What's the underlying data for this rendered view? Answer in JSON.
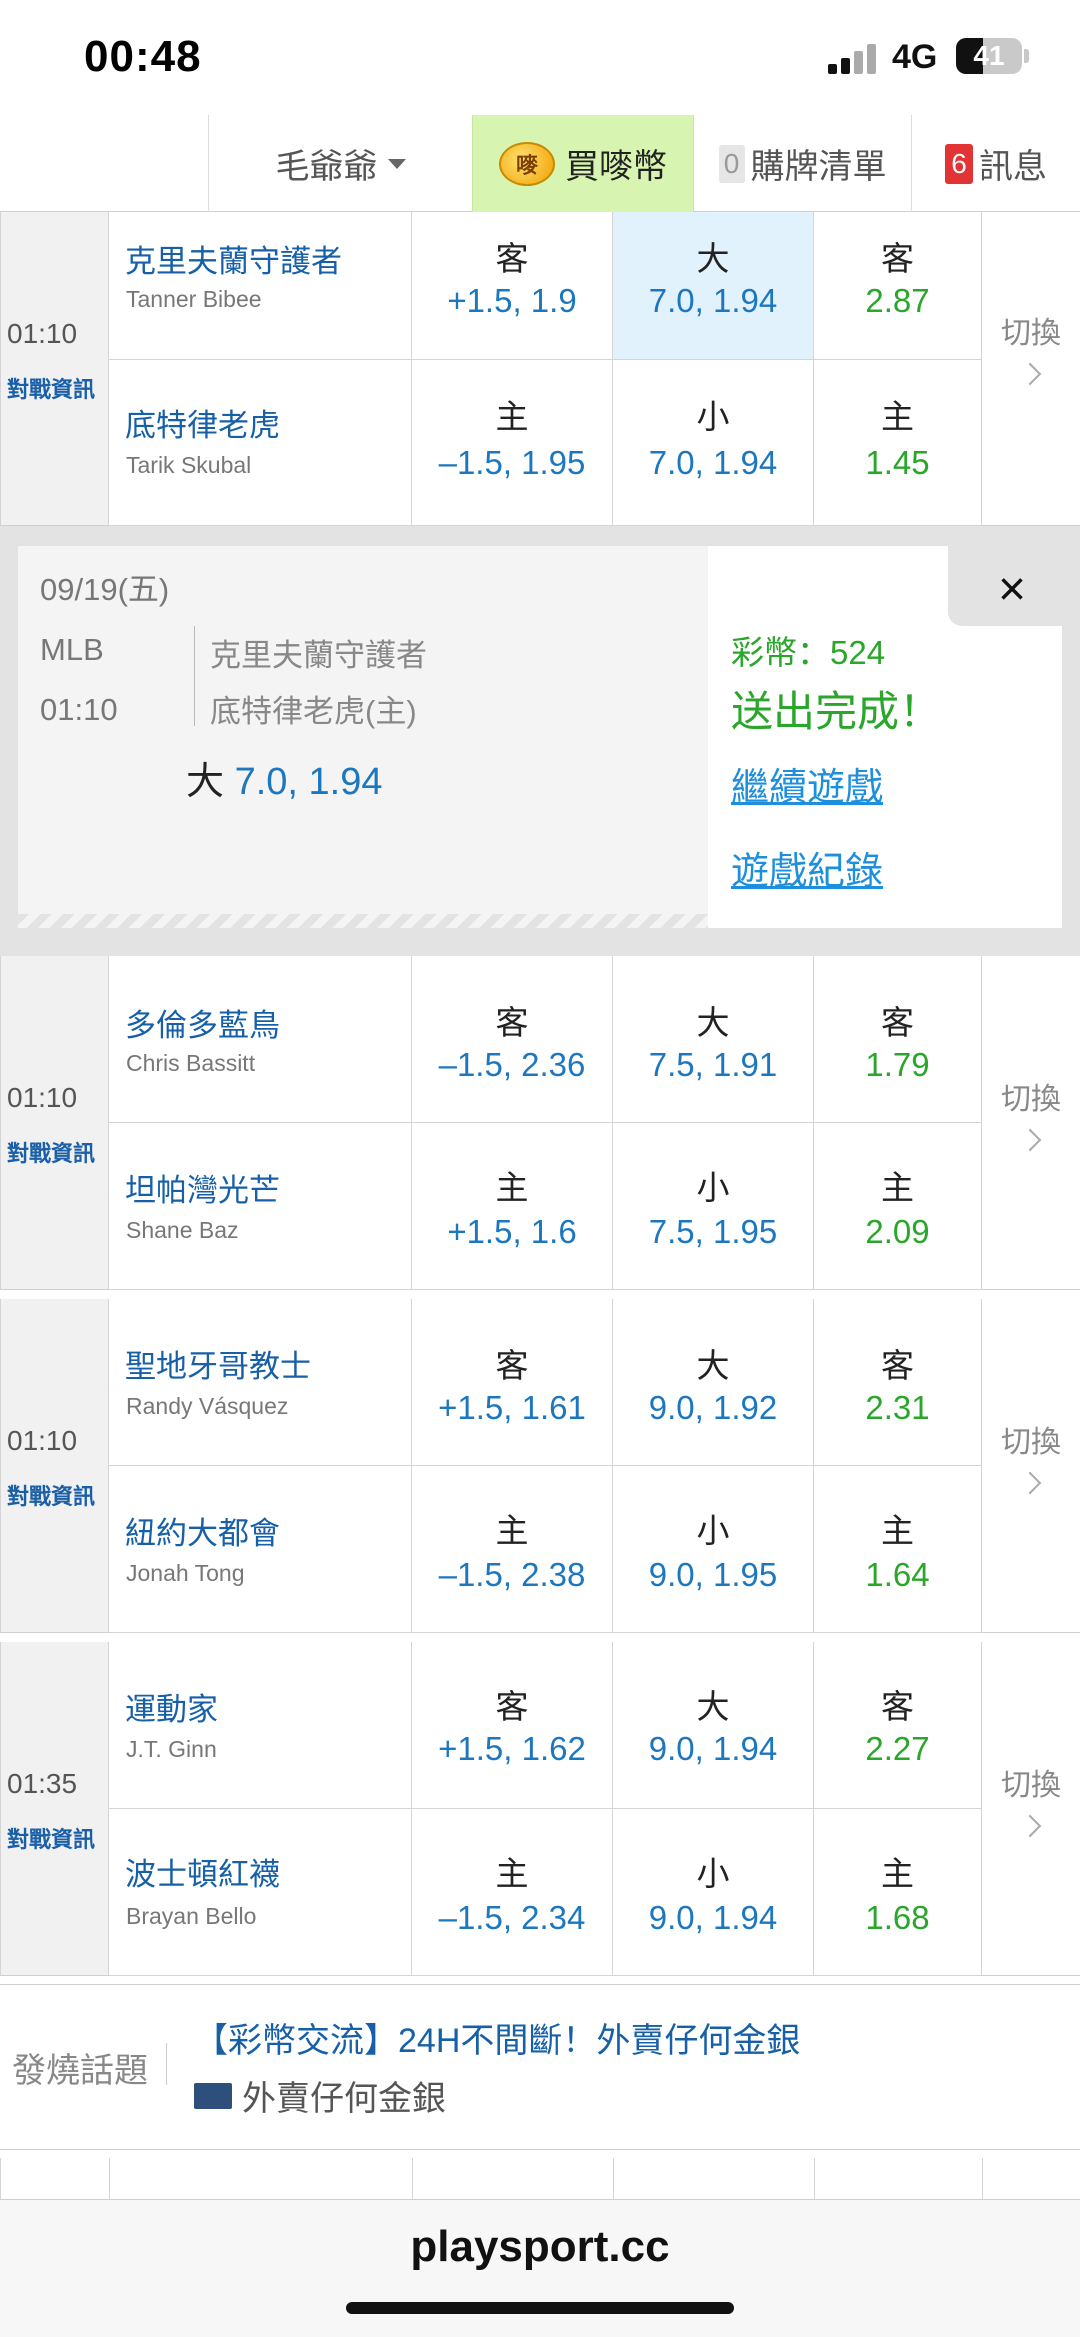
{
  "status": {
    "time": "00:48",
    "network": "4G",
    "battery": "41",
    "battery_level": 0.41
  },
  "topbar": {
    "user": "毛爺爺",
    "coin_icon_text": "嘜",
    "buy_coin": "買嘜幣",
    "cart_count": "0",
    "cart": "購牌清單",
    "msg_count": "6",
    "messages": "訊息"
  },
  "games": [
    {
      "time": "01:10",
      "info": "對戰資訊",
      "switch": "切換",
      "away": {
        "team": "克里夫蘭守護者",
        "pitcher": "Tanner Bibee",
        "spread_label": "客",
        "spread": "+1.5, 1.9",
        "total_label": "大",
        "total": "7.0, 1.94",
        "ml_label": "客",
        "ml": "2.87"
      },
      "home": {
        "team": "底特律老虎",
        "pitcher": "Tarik Skubal",
        "spread_label": "主",
        "spread": "–1.5, 1.95",
        "total_label": "小",
        "total": "7.0, 1.94",
        "ml_label": "主",
        "ml": "1.45"
      }
    },
    {
      "time": "01:10",
      "info": "對戰資訊",
      "switch": "切換",
      "away": {
        "team": "多倫多藍鳥",
        "pitcher": "Chris Bassitt",
        "spread_label": "客",
        "spread": "–1.5, 2.36",
        "total_label": "大",
        "total": "7.5, 1.91",
        "ml_label": "客",
        "ml": "1.79"
      },
      "home": {
        "team": "坦帕灣光芒",
        "pitcher": "Shane Baz",
        "spread_label": "主",
        "spread": "+1.5, 1.6",
        "total_label": "小",
        "total": "7.5, 1.95",
        "ml_label": "主",
        "ml": "2.09"
      }
    },
    {
      "time": "01:10",
      "info": "對戰資訊",
      "switch": "切換",
      "away": {
        "team": "聖地牙哥教士",
        "pitcher": "Randy Vásquez",
        "spread_label": "客",
        "spread": "+1.5, 1.61",
        "total_label": "大",
        "total": "9.0, 1.92",
        "ml_label": "客",
        "ml": "2.31"
      },
      "home": {
        "team": "紐約大都會",
        "pitcher": "Jonah Tong",
        "spread_label": "主",
        "spread": "–1.5, 2.38",
        "total_label": "小",
        "total": "9.0, 1.95",
        "ml_label": "主",
        "ml": "1.64"
      }
    },
    {
      "time": "01:35",
      "info": "對戰資訊",
      "switch": "切換",
      "away": {
        "team": "運動家",
        "pitcher": "J.T. Ginn",
        "spread_label": "客",
        "spread": "+1.5, 1.62",
        "total_label": "大",
        "total": "9.0, 1.94",
        "ml_label": "客",
        "ml": "2.27"
      },
      "home": {
        "team": "波士頓紅襪",
        "pitcher": "Brayan Bello",
        "spread_label": "主",
        "spread": "–1.5, 2.34",
        "total_label": "小",
        "total": "9.0, 1.94",
        "ml_label": "主",
        "ml": "1.68"
      }
    }
  ],
  "popup": {
    "date": "09/19(五)",
    "league": "MLB",
    "time": "01:10",
    "team1": "克里夫蘭守護者",
    "team2": "底特律老虎(主)",
    "bet_label": "大",
    "bet_value": "7.0, 1.94",
    "coins": "彩幣：524",
    "done": "送出完成！",
    "continue": "繼續遊戲",
    "records": "遊戲紀錄",
    "close": "×"
  },
  "topic": {
    "label": "發燒話題",
    "title": "【彩幣交流】24H不間斷！外賣仔何金銀",
    "author": "外賣仔何金銀"
  },
  "footer": {
    "url": "playsport.cc"
  }
}
